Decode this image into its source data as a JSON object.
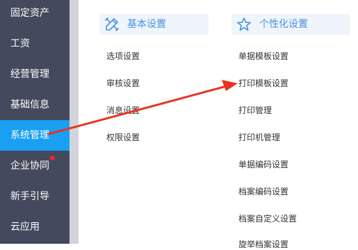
{
  "sidebar": {
    "items": [
      {
        "label": "固定资产"
      },
      {
        "label": "工资"
      },
      {
        "label": "经营管理"
      },
      {
        "label": "基础信息"
      },
      {
        "label": "系统管理"
      },
      {
        "label": "企业协同"
      },
      {
        "label": "新手引导"
      },
      {
        "label": "云应用"
      }
    ],
    "active_item": "系统管理"
  },
  "basic_settings": {
    "title": "基本设置",
    "icon": "pencil-ruler-icon",
    "items": [
      "选项设置",
      "审核设置",
      "消息设置",
      "权限设置"
    ]
  },
  "personalization": {
    "title": "个性化设置",
    "icon": "star-icon",
    "items": [
      "单据模板设置",
      "打印模板设置",
      "打印管理",
      "打印机管理",
      "单据编码设置",
      "档案编码设置",
      "档案自定义设置",
      "旋举档案设置"
    ]
  },
  "colors": {
    "sidebar_bg": "#434a5e",
    "active_bg": "#1aa0f2",
    "accent": "#4a90e2",
    "annotation_arrow": "#ea3323"
  }
}
